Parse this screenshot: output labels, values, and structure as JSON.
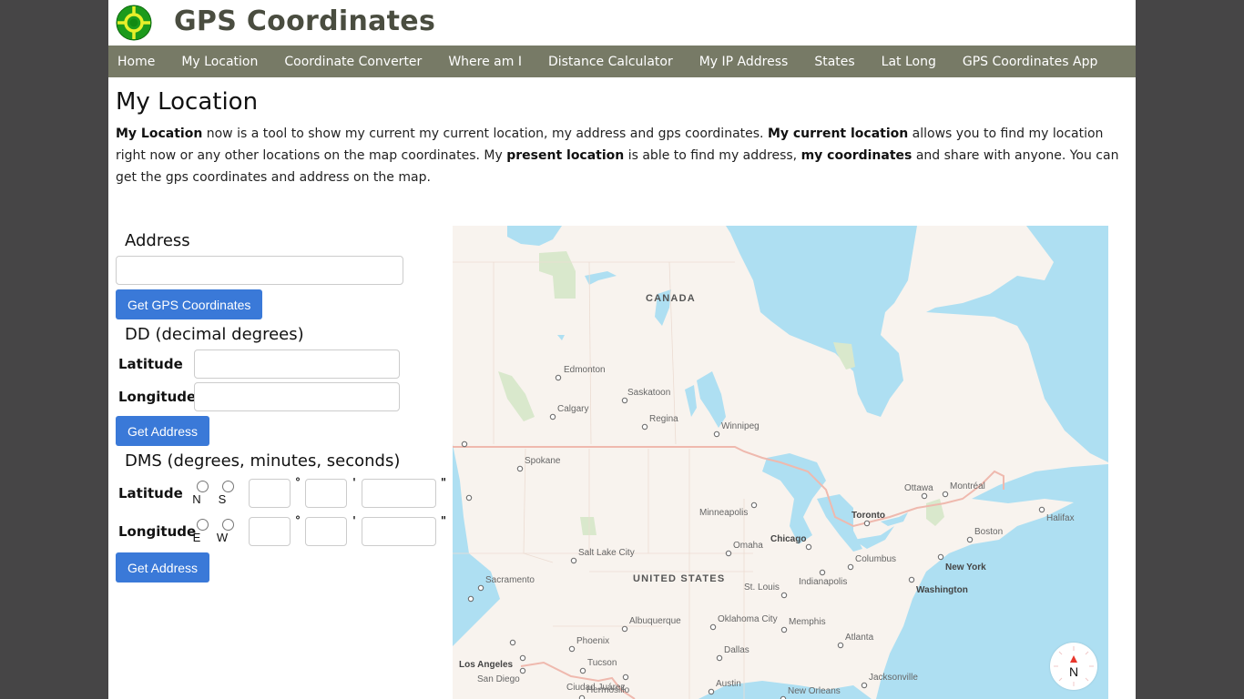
{
  "site": {
    "title": "GPS Coordinates",
    "logo_icon": "crosshair-target-icon"
  },
  "nav": {
    "items": [
      {
        "label": "Home"
      },
      {
        "label": "My Location"
      },
      {
        "label": "Coordinate Converter"
      },
      {
        "label": "Where am I"
      },
      {
        "label": "Distance Calculator"
      },
      {
        "label": "My IP Address"
      },
      {
        "label": "States"
      },
      {
        "label": "Lat Long"
      },
      {
        "label": "GPS Coordinates App"
      }
    ]
  },
  "page": {
    "title": "My Location",
    "intro": {
      "b1": "My Location",
      "t1": " now is a tool to show my current my current location, my address and gps coordinates. ",
      "b2": "My current location",
      "t2": " allows you to find my location right now or any other locations on the map coordinates. My ",
      "b3": "present location",
      "t3": " is able to find my address, ",
      "b4": "my coordinates",
      "t4": " and share with anyone. You can get the gps coordinates and address on the map."
    }
  },
  "tools": {
    "address": {
      "title": "Address",
      "value": "",
      "button": "Get GPS Coordinates"
    },
    "dd": {
      "title": "DD (decimal degrees)",
      "latitude_label": "Latitude",
      "longitude_label": "Longitude",
      "latitude_value": "",
      "longitude_value": "",
      "button": "Get Address"
    },
    "dms": {
      "title": "DMS (degrees, minutes, seconds)",
      "latitude_label": "Latitude",
      "longitude_label": "Longitude",
      "lat_dirs": [
        "N",
        "S"
      ],
      "lon_dirs": [
        "E",
        "W"
      ],
      "degree_symbol": "°",
      "minute_symbol": "'",
      "second_symbol": "\"",
      "button": "Get Address"
    }
  },
  "map": {
    "country_labels": [
      "CANADA",
      "UNITED STATES"
    ],
    "cities": [
      {
        "name": "Edmonton",
        "bold": false
      },
      {
        "name": "Saskatoon",
        "bold": false
      },
      {
        "name": "Calgary",
        "bold": false
      },
      {
        "name": "Regina",
        "bold": false
      },
      {
        "name": "Winnipeg",
        "bold": false
      },
      {
        "name": "Spokane",
        "bold": false
      },
      {
        "name": "Minneapolis",
        "bold": false
      },
      {
        "name": "Chicago",
        "bold": true
      },
      {
        "name": "Omaha",
        "bold": false
      },
      {
        "name": "Salt Lake City",
        "bold": false
      },
      {
        "name": "Sacramento",
        "bold": false
      },
      {
        "name": "St. Louis",
        "bold": false
      },
      {
        "name": "Indianapolis",
        "bold": false
      },
      {
        "name": "Columbus",
        "bold": false
      },
      {
        "name": "Toronto",
        "bold": true
      },
      {
        "name": "Ottawa",
        "bold": false
      },
      {
        "name": "Montréal",
        "bold": false
      },
      {
        "name": "Boston",
        "bold": false
      },
      {
        "name": "Halifax",
        "bold": false
      },
      {
        "name": "New York",
        "bold": true
      },
      {
        "name": "Washington",
        "bold": true
      },
      {
        "name": "Albuquerque",
        "bold": false
      },
      {
        "name": "Oklahoma City",
        "bold": false
      },
      {
        "name": "Memphis",
        "bold": false
      },
      {
        "name": "Phoenix",
        "bold": false
      },
      {
        "name": "Tucson",
        "bold": false
      },
      {
        "name": "Los Angeles",
        "bold": true
      },
      {
        "name": "San Diego",
        "bold": false
      },
      {
        "name": "Dallas",
        "bold": false
      },
      {
        "name": "Atlanta",
        "bold": false
      },
      {
        "name": "Ciudad Juárez",
        "bold": false
      },
      {
        "name": "Hermosillo",
        "bold": false
      },
      {
        "name": "Austin",
        "bold": false
      },
      {
        "name": "New Orleans",
        "bold": false
      },
      {
        "name": "Jacksonville",
        "bold": false
      }
    ],
    "compass_label": "N"
  }
}
